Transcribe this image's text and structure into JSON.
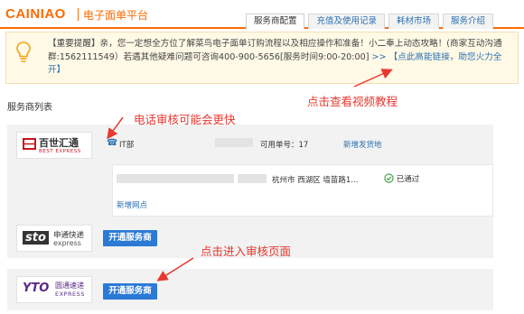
{
  "header": {
    "brand": "CAINIAO",
    "subtitle": "电子面单平台",
    "tabs": [
      {
        "label": "服务商配置",
        "active": true
      },
      {
        "label": "充值及使用记录",
        "active": false
      },
      {
        "label": "耗材市场",
        "active": false
      },
      {
        "label": "服务介绍",
        "active": false
      }
    ]
  },
  "notice": {
    "text": "【重要提醒】亲，您一定想全方位了解菜鸟电子面单订购流程以及相应操作和准备！小二奉上动态攻略！(商家互动沟通群:1562111549）若遇其他疑难问题可咨询400-900-5656[服务时间9:00-20:00] ",
    "link": ">> 【点此高能链接，助您火力全开】"
  },
  "section_title": "服务商列表",
  "providers": [
    {
      "logo_cn": "百世汇通",
      "logo_en": "BEST EXPRESS",
      "contact_icon": "phone-icon",
      "contact": "IT部",
      "available_label": "可用单号：17",
      "add_site_label": "新增发货地",
      "address_tail": "杭州市 西湖区 墙苗路1...",
      "status": "已通过",
      "add_branch_label": "新增网点"
    },
    {
      "logo_cn": "申通快递",
      "logo_en": "express",
      "logo_mark": "sto",
      "button": "开通服务商"
    },
    {
      "logo_cn": "圆通速递",
      "logo_en": "EXPRESS",
      "logo_mark": "YTO",
      "button": "开通服务商"
    }
  ],
  "annotations": {
    "video": "点击查看视频教程",
    "phone": "电话审核可能会更快",
    "enter": "点击进入审核页面"
  },
  "colors": {
    "brand_orange": "#ff6a00",
    "link_blue": "#2a6fb0",
    "button_blue": "#2b7ad6",
    "annotation_red": "#e8382f",
    "status_green": "#3a9a3a"
  }
}
